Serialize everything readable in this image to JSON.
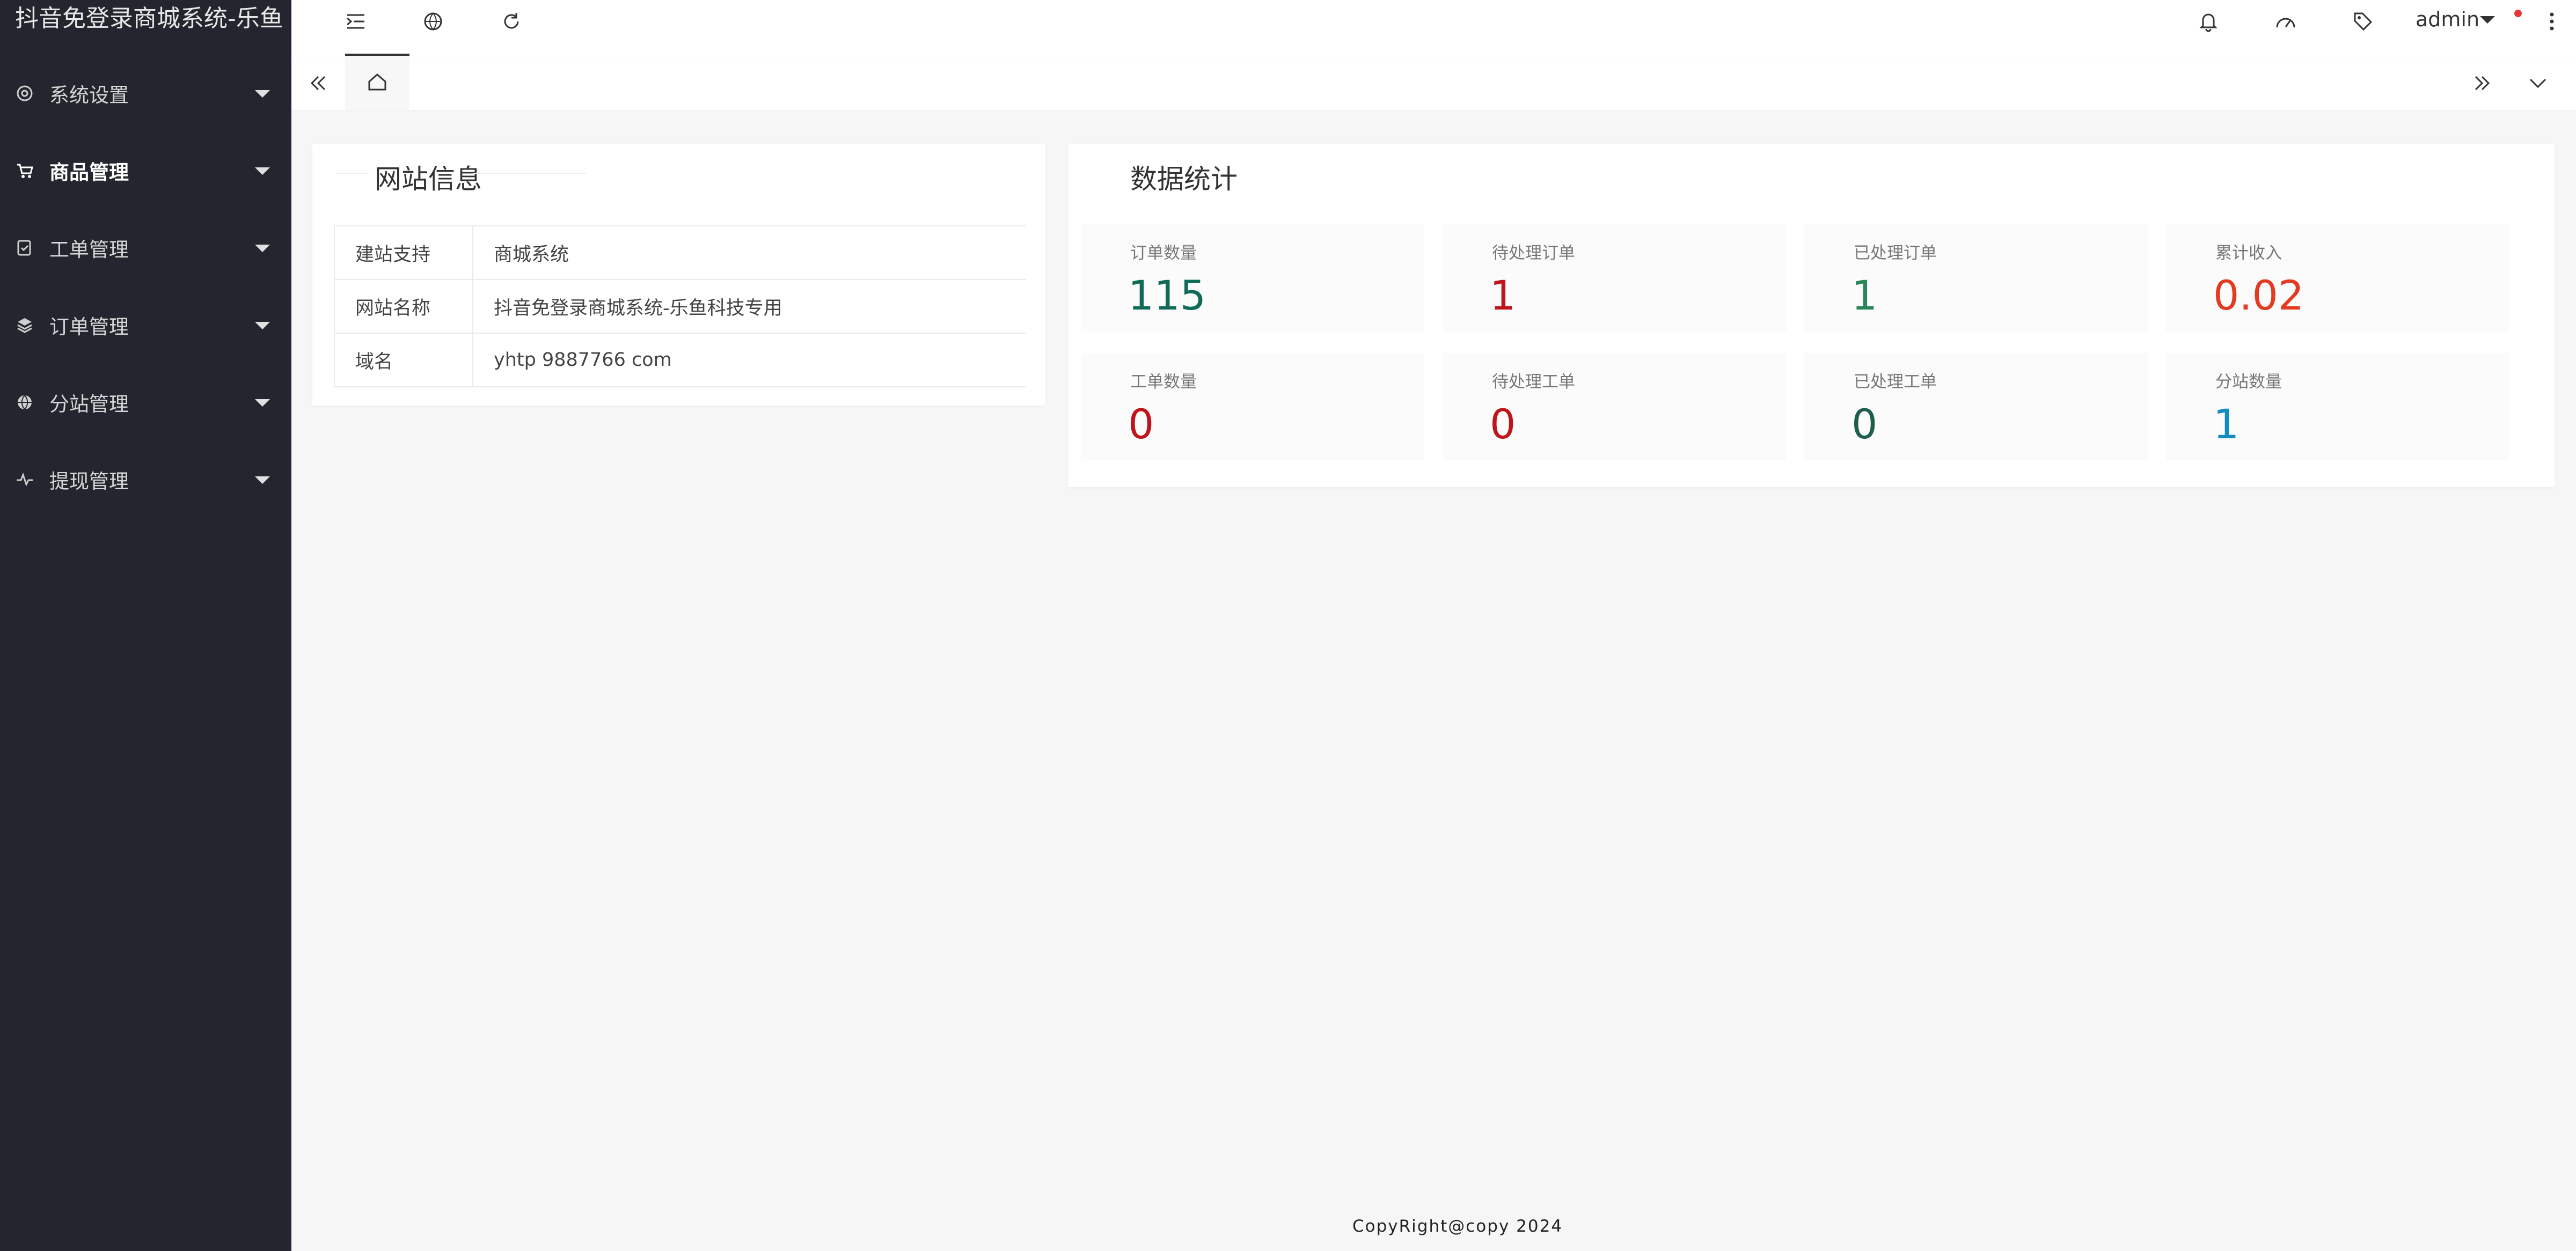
{
  "app": {
    "title": "抖音免登录商城系统-乐鱼"
  },
  "sidebar": {
    "items": [
      {
        "label": "系统设置",
        "icon": "settings-icon"
      },
      {
        "label": "商品管理",
        "icon": "cart-icon"
      },
      {
        "label": "工单管理",
        "icon": "ticket-icon"
      },
      {
        "label": "订单管理",
        "icon": "box-icon"
      },
      {
        "label": "分站管理",
        "icon": "globe-icon"
      },
      {
        "label": "提现管理",
        "icon": "pulse-icon"
      }
    ]
  },
  "header": {
    "user": "admin"
  },
  "site_info": {
    "title": "网站信息",
    "rows": [
      {
        "key": "建站支持",
        "value": "商城系统"
      },
      {
        "key": "网站名称",
        "value": "抖音免登录商城系统-乐鱼科技专用"
      },
      {
        "key": "域名",
        "value": "yhtp 9887766 com"
      }
    ]
  },
  "stats": {
    "title": "数据统计",
    "items": [
      {
        "label": "订单数量",
        "value": "115",
        "color": "#0f6b56"
      },
      {
        "label": "待处理订单",
        "value": "1",
        "color": "#c0141b"
      },
      {
        "label": "已处理订单",
        "value": "1",
        "color": "#27865a"
      },
      {
        "label": "累计收入",
        "value": "0.02",
        "color": "#e23b22"
      },
      {
        "label": "工单数量",
        "value": "0",
        "color": "#c0141b"
      },
      {
        "label": "待处理工单",
        "value": "0",
        "color": "#c0141b"
      },
      {
        "label": "已处理工单",
        "value": "0",
        "color": "#1f5e4c"
      },
      {
        "label": "分站数量",
        "value": "1",
        "color": "#0f8cc0"
      }
    ]
  },
  "footer": {
    "text": "CopyRight@copy 2024"
  }
}
